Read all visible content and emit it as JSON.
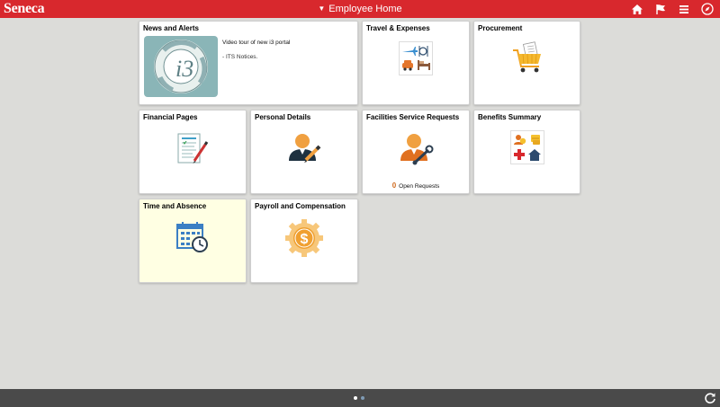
{
  "header": {
    "logo": "Seneca",
    "title": "Employee Home",
    "icons": [
      "home-icon",
      "flag-icon",
      "menu-icon",
      "compass-icon"
    ],
    "bar_color": "#d8282d"
  },
  "tiles": {
    "news": {
      "title": "News and Alerts",
      "text1": "Video tour of new i3 portal",
      "text2": "- ITS Notices.",
      "image_words": [
        "information",
        "integration",
        "innovation"
      ],
      "image_letter": "i3"
    },
    "travel": {
      "title": "Travel & Expenses"
    },
    "procurement": {
      "title": "Procurement"
    },
    "financial": {
      "title": "Financial Pages"
    },
    "personal": {
      "title": "Personal Details"
    },
    "facilities": {
      "title": "Facilities Service Requests",
      "count": "0",
      "count_label": "Open Requests"
    },
    "benefits": {
      "title": "Benefits Summary"
    },
    "time": {
      "title": "Time and Absence"
    },
    "payroll": {
      "title": "Payroll and Compensation"
    }
  },
  "footer": {
    "page_dots": 2,
    "active_page": 1,
    "refresh_icon": "refresh-icon"
  }
}
